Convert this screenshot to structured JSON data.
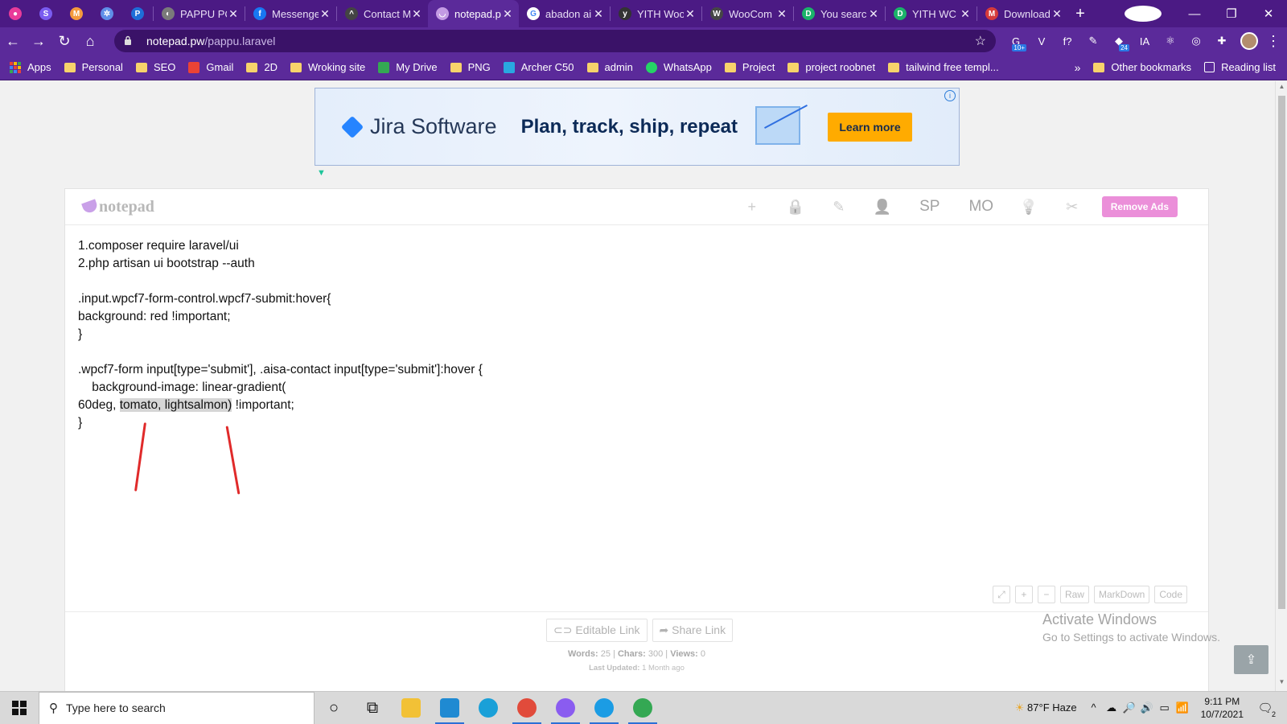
{
  "browser": {
    "tabs": [
      {
        "label": "",
        "pinned": true,
        "favicon_color": "#e93b9a",
        "glyph": "●",
        "active": false
      },
      {
        "label": "",
        "pinned": true,
        "favicon_color": "#7a5cf0",
        "glyph": "S",
        "active": false
      },
      {
        "label": "",
        "pinned": true,
        "favicon_color": "#f49a3d",
        "glyph": "M",
        "active": false
      },
      {
        "label": "",
        "pinned": true,
        "favicon_color": "#5f8ee8",
        "glyph": "✲",
        "active": false
      },
      {
        "label": "",
        "pinned": true,
        "favicon_color": "#1e6ed8",
        "glyph": "P",
        "active": false
      },
      {
        "label": "PAPPU PC",
        "pinned": false,
        "favicon_color": "#7a7a7a",
        "glyph": "◐",
        "active": false
      },
      {
        "label": "Messenger",
        "pinned": false,
        "favicon_color": "#1877f2",
        "glyph": "f",
        "active": false
      },
      {
        "label": "Contact M",
        "pinned": false,
        "favicon_color": "#444",
        "glyph": "^",
        "active": false
      },
      {
        "label": "notepad.pw",
        "pinned": false,
        "favicon_color": "#c39be4",
        "glyph": "◡",
        "active": true
      },
      {
        "label": "abadon ai",
        "pinned": false,
        "favicon_color": "#fff",
        "glyph": "G",
        "active": false
      },
      {
        "label": "YITH Woo",
        "pinned": false,
        "favicon_color": "#333",
        "glyph": "y",
        "active": false
      },
      {
        "label": "WooCom",
        "pinned": false,
        "favicon_color": "#464646",
        "glyph": "W",
        "active": false
      },
      {
        "label": "You searc",
        "pinned": false,
        "favicon_color": "#1bb36a",
        "glyph": "D",
        "active": false
      },
      {
        "label": "YITH WC",
        "pinned": false,
        "favicon_color": "#1bb36a",
        "glyph": "D",
        "active": false
      },
      {
        "label": "Download",
        "pinned": false,
        "favicon_color": "#d63b3b",
        "glyph": "M",
        "active": false
      }
    ],
    "close_glyph": "✕",
    "new_tab_glyph": "+",
    "window_controls": {
      "min": "—",
      "max": "❐",
      "close": "✕"
    },
    "nav": {
      "back": "←",
      "forward": "→",
      "reload": "↻",
      "home": "⌂"
    },
    "address": {
      "host": "notepad.pw",
      "path": "/pappu.laravel",
      "star": "☆"
    },
    "extensions": [
      {
        "name": "grammarly-ext",
        "glyph": "G",
        "badge": "10+"
      },
      {
        "name": "vue-ext",
        "glyph": "V",
        "badge": ""
      },
      {
        "name": "formula-ext",
        "glyph": "f?",
        "badge": ""
      },
      {
        "name": "pen-ext",
        "glyph": "✎",
        "badge": ""
      },
      {
        "name": "counter-ext",
        "glyph": "◆",
        "badge": "24"
      },
      {
        "name": "ia-ext",
        "glyph": "IA",
        "badge": ""
      },
      {
        "name": "react-ext",
        "glyph": "⚛",
        "badge": ""
      },
      {
        "name": "target-ext",
        "glyph": "◎",
        "badge": ""
      },
      {
        "name": "puzzle-ext",
        "glyph": "✚",
        "badge": ""
      }
    ],
    "menu_glyph": "⋮"
  },
  "bookmarks": {
    "items": [
      {
        "label": "Apps",
        "type": "apps"
      },
      {
        "label": "Personal",
        "type": "folder"
      },
      {
        "label": "SEO",
        "type": "folder"
      },
      {
        "label": "Gmail",
        "type": "gmail"
      },
      {
        "label": "2D",
        "type": "folder"
      },
      {
        "label": "Wroking site",
        "type": "folder"
      },
      {
        "label": "My Drive",
        "type": "drive"
      },
      {
        "label": "PNG",
        "type": "folder"
      },
      {
        "label": "Archer C50",
        "type": "link"
      },
      {
        "label": "admin",
        "type": "folder"
      },
      {
        "label": "WhatsApp",
        "type": "whatsapp"
      },
      {
        "label": "Project",
        "type": "folder"
      },
      {
        "label": "project roobnet",
        "type": "folder"
      },
      {
        "label": "tailwind free templ...",
        "type": "folder"
      }
    ],
    "overflow": "»",
    "other": "Other bookmarks",
    "reading_list": "Reading list"
  },
  "ad": {
    "brand": "Jira Software",
    "slogan": "Plan, track, ship, repeat",
    "cta": "Learn more",
    "info": "i",
    "mark": "▼"
  },
  "notepad": {
    "logo": "notepad",
    "tools": [
      {
        "name": "new-note",
        "glyph": "+",
        "kind": "icon"
      },
      {
        "name": "lock",
        "glyph": "🔒",
        "kind": "icon"
      },
      {
        "name": "edit",
        "glyph": "✎",
        "kind": "icon"
      },
      {
        "name": "user",
        "glyph": "👤",
        "kind": "icon"
      },
      {
        "name": "sp",
        "glyph": "SP",
        "kind": "text"
      },
      {
        "name": "mo",
        "glyph": "MO",
        "kind": "text"
      },
      {
        "name": "lightbulb",
        "glyph": "💡",
        "kind": "icon"
      },
      {
        "name": "settings",
        "glyph": "✂",
        "kind": "icon"
      }
    ],
    "remove_ads": "Remove Ads",
    "text": {
      "l1": "1.composer require laravel/ui",
      "l2": "2.php artisan ui bootstrap --auth",
      "l3": ".input.wpcf7-form-control.wpcf7-submit:hover{",
      "l4": "background: red !important;",
      "l5": "}",
      "l6": ".wpcf7-form input[type='submit'], .aisa-contact input[type='submit']:hover {",
      "l7": "    background-image: linear-gradient(",
      "l8_pre": "60deg, ",
      "l8_hl": "tomato, lightsalmon)",
      "l8_post": " !important;",
      "l9": "}"
    },
    "mini": {
      "expand": "⤢",
      "zoom_in": "+",
      "zoom_out": "−",
      "raw": "Raw",
      "markdown": "MarkDown",
      "code": "Code"
    },
    "links": {
      "editable": "⊂⊃ Editable Link",
      "share": "➦ Share Link"
    },
    "stats": {
      "words_label": "Words:",
      "words": "25",
      "chars_label": "Chars:",
      "chars": "300",
      "views_label": "Views:",
      "views": "0"
    },
    "updated": {
      "label": "Last Updated:",
      "value": "1 Month ago"
    }
  },
  "activate_windows": {
    "line1": "Activate Windows",
    "line2": "Go to Settings to activate Windows."
  },
  "share_float": "⇪",
  "taskbar": {
    "search_placeholder": "Type here to search",
    "apps": [
      {
        "name": "cortana",
        "color": "#111",
        "running": false,
        "glyph": "○"
      },
      {
        "name": "task-view",
        "color": "#111",
        "running": false,
        "glyph": "⧉"
      },
      {
        "name": "file-explorer",
        "color": "#f2c136",
        "running": false,
        "glyph": ""
      },
      {
        "name": "vscode",
        "color": "#1f8ad2",
        "running": true,
        "glyph": ""
      },
      {
        "name": "edge",
        "color": "#1aa0d8",
        "running": false,
        "glyph": ""
      },
      {
        "name": "chrome",
        "color": "#e14b3b",
        "running": true,
        "glyph": ""
      },
      {
        "name": "discord",
        "color": "#8a5cf0",
        "running": true,
        "glyph": ""
      },
      {
        "name": "skype",
        "color": "#1b9ce4",
        "running": true,
        "glyph": ""
      },
      {
        "name": "chrome-profile",
        "color": "#34a853",
        "running": true,
        "glyph": ""
      }
    ],
    "weather": "87°F  Haze",
    "tray_icons": [
      "^",
      "☁",
      "🔎",
      "🔊",
      "▭",
      "📶"
    ],
    "time": "9:11 PM",
    "date": "10/7/2021",
    "notifications": "2"
  }
}
